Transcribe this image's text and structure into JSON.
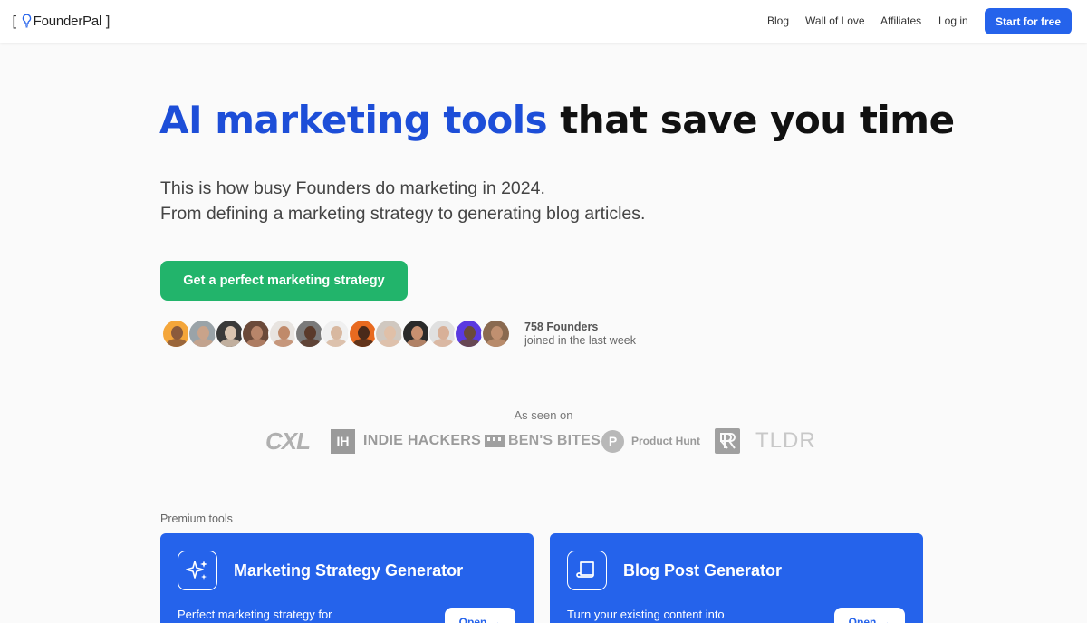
{
  "brand": {
    "name": "FounderPal",
    "bracket_left": "[",
    "bracket_right": "]"
  },
  "nav": {
    "links": [
      "Blog",
      "Wall of Love",
      "Affiliates",
      "Log in"
    ],
    "cta": "Start for free"
  },
  "hero": {
    "title_highlight": "AI marketing tools",
    "title_rest": "that save you time",
    "subtitle_line1": "This is how busy Founders do marketing in 2024.",
    "subtitle_line2": "From defining a marketing strategy to generating blog articles.",
    "cta": "Get a perfect marketing strategy"
  },
  "social_proof": {
    "count": "758 Founders",
    "caption": "joined in the last week",
    "avatars": [
      {
        "bg": "#f4a63a",
        "skin": "#8a5a3c"
      },
      {
        "bg": "#9aa3a8",
        "skin": "#c9a38a"
      },
      {
        "bg": "#3a3a3a",
        "skin": "#d9c4b0"
      },
      {
        "bg": "#6b4a3a",
        "skin": "#b8856a"
      },
      {
        "bg": "#e8e4e0",
        "skin": "#c08a6a"
      },
      {
        "bg": "#7a7a7a",
        "skin": "#5a3a2a"
      },
      {
        "bg": "#f0f0f0",
        "skin": "#d8b8a0"
      },
      {
        "bg": "#e86a20",
        "skin": "#4a2a1a"
      },
      {
        "bg": "#d0c8c0",
        "skin": "#e0c0a8"
      },
      {
        "bg": "#2a2a2a",
        "skin": "#c89070"
      },
      {
        "bg": "#e0e0e0",
        "skin": "#d8b098"
      },
      {
        "bg": "#5a3ae0",
        "skin": "#6a4a3a"
      },
      {
        "bg": "#8a6a50",
        "skin": "#c09070"
      }
    ]
  },
  "as_seen_on": {
    "label": "As seen on",
    "logos": [
      "CXL",
      "IH",
      "INDIE HACKERS",
      "BEN'S BITES",
      "P",
      "Product Hunt",
      "TLDR"
    ]
  },
  "premium": {
    "label": "Premium tools",
    "cards": [
      {
        "title": "Marketing Strategy Generator",
        "desc": "Perfect marketing strategy for",
        "button": "Open",
        "icon": "sparkles-icon"
      },
      {
        "title": "Blog Post Generator",
        "desc": "Turn your existing content into",
        "button": "Open",
        "icon": "document-icon"
      }
    ]
  },
  "colors": {
    "primary": "#2563eb",
    "heading_blue": "#1d4ed8",
    "cta_green": "#22b46b"
  }
}
